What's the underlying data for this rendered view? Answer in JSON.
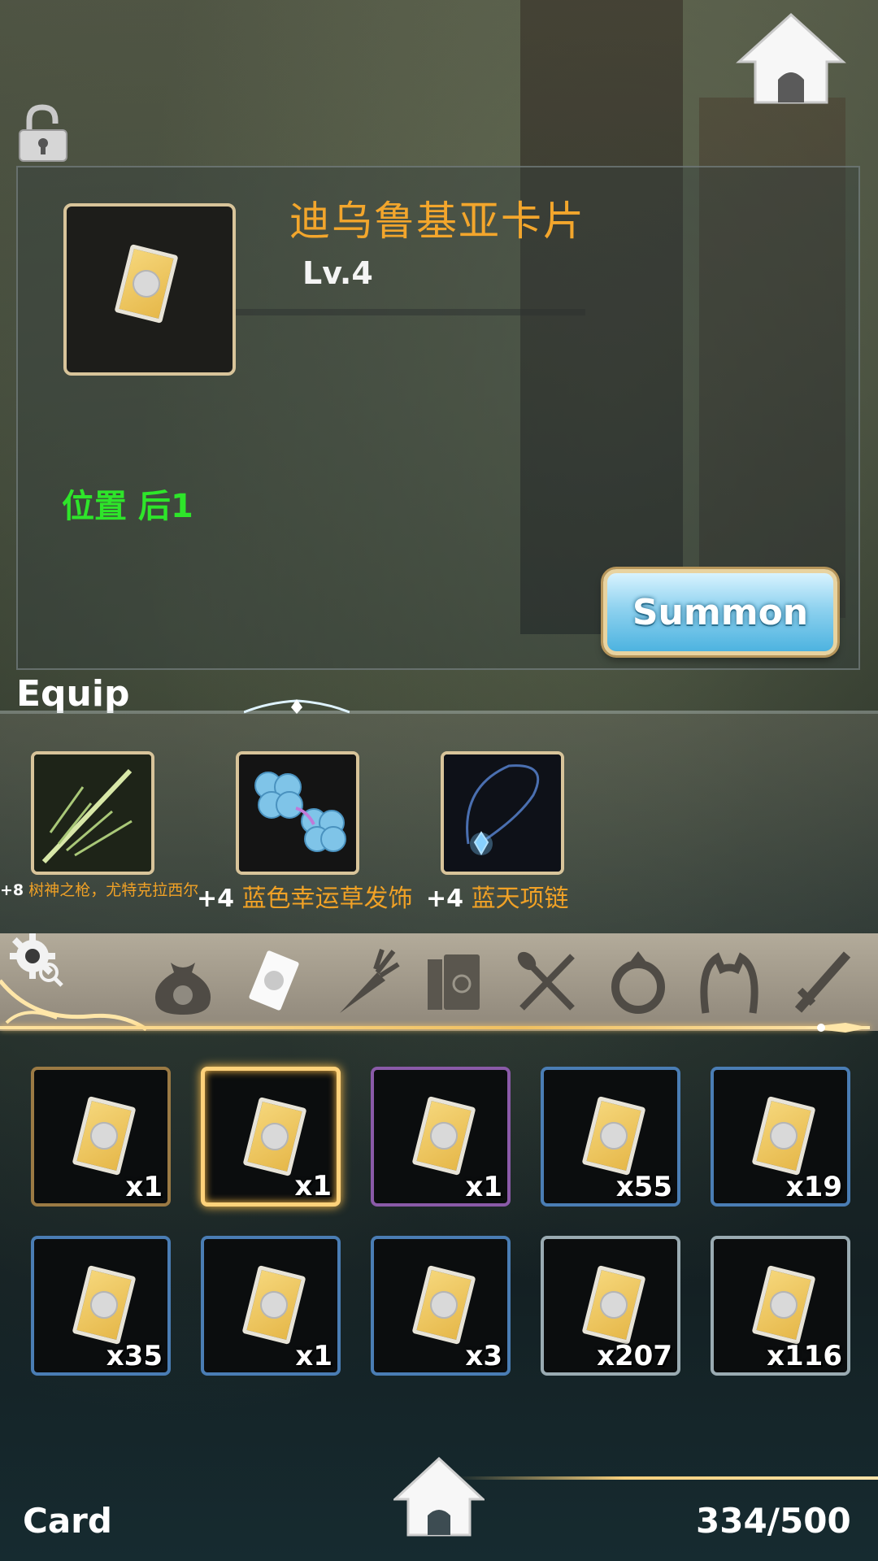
{
  "item": {
    "name": "迪乌鲁基亚卡片",
    "level": "Lv.4",
    "position_label": "位置 后",
    "position_value": "1"
  },
  "buttons": {
    "summon": "Summon"
  },
  "equip": {
    "title": "Equip",
    "slots": [
      {
        "plus": "+8",
        "name": "树神之枪，尤特克拉西尔",
        "icon": "spear-icon"
      },
      {
        "plus": "+4",
        "name": "蓝色幸运草发饰",
        "icon": "clover-hairpin-icon"
      },
      {
        "plus": "+4",
        "name": "蓝天项链",
        "icon": "necklace-icon"
      }
    ]
  },
  "tabs": [
    {
      "id": "bag",
      "icon": "bag-icon"
    },
    {
      "id": "card",
      "icon": "card-icon",
      "selected": true
    },
    {
      "id": "material",
      "icon": "carrot-icon"
    },
    {
      "id": "books",
      "icon": "books-icon"
    },
    {
      "id": "food",
      "icon": "spoon-fork-icon"
    },
    {
      "id": "ring",
      "icon": "ring-icon"
    },
    {
      "id": "headgear",
      "icon": "headband-icon"
    },
    {
      "id": "weapon",
      "icon": "sword-icon"
    }
  ],
  "inventory": [
    {
      "qty": "x1",
      "rarity": "gold"
    },
    {
      "qty": "x1",
      "rarity": "selected"
    },
    {
      "qty": "x1",
      "rarity": "purple"
    },
    {
      "qty": "x55",
      "rarity": "blue"
    },
    {
      "qty": "x19",
      "rarity": "blue"
    },
    {
      "qty": "x35",
      "rarity": "blue"
    },
    {
      "qty": "x1",
      "rarity": "blue"
    },
    {
      "qty": "x3",
      "rarity": "blue"
    },
    {
      "qty": "x207",
      "rarity": "silver"
    },
    {
      "qty": "x116",
      "rarity": "silver"
    }
  ],
  "footer": {
    "category": "Card",
    "capacity": "334/500"
  },
  "colors": {
    "item_name": "#f3a62c",
    "position": "#2ee52a",
    "summon_btn": "#8fd2ef",
    "frame_gold": "#d8c49a"
  }
}
